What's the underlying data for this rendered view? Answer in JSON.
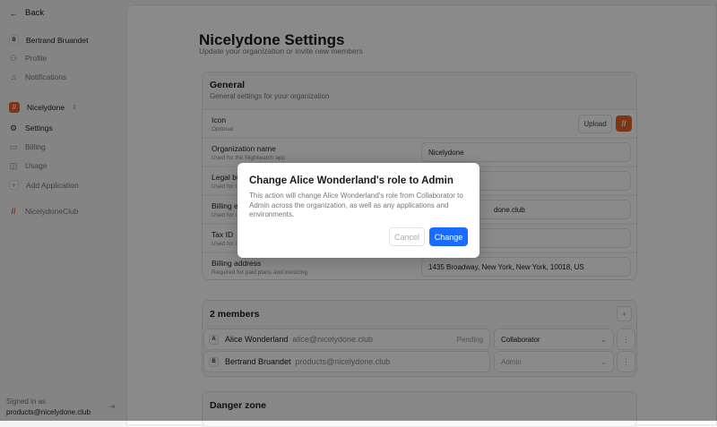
{
  "sidebar": {
    "back": "Back",
    "user": {
      "initial": "B",
      "name": "Bertrand Bruandet"
    },
    "user_items": [
      {
        "label": "Profile",
        "icon": "user-icon"
      },
      {
        "label": "Notifications",
        "icon": "bell-icon"
      }
    ],
    "org": {
      "name": "Nicelydone"
    },
    "org_items": [
      {
        "label": "Settings"
      },
      {
        "label": "Billing"
      },
      {
        "label": "Usage"
      },
      {
        "label": "Add Application"
      }
    ],
    "other_org": "NicelydoneClub",
    "signed_in_label": "Signed in as",
    "signed_in_email": "products@nicelydone.club"
  },
  "page": {
    "title": "Nicelydone Settings",
    "subtitle": "Update your organization or invite new members"
  },
  "general": {
    "title": "General",
    "subtitle": "General settings for your organization",
    "icon_label": "Icon",
    "icon_sub": "Optional",
    "upload": "Upload",
    "rows": [
      {
        "label": "Organization name",
        "sub": "Used for the Nightwatch app",
        "value": "Nicelydone"
      },
      {
        "label": "Legal bu",
        "sub": "Used for i",
        "value": ""
      },
      {
        "label": "Billing em",
        "sub": "Used for i",
        "value": "done.club"
      },
      {
        "label": "Tax ID",
        "sub": "Used for i",
        "value": ""
      },
      {
        "label": "Billing address",
        "sub": "Required for paid plans and invoicing",
        "value": "1435 Broadway, New York, New York, 10018, US"
      }
    ]
  },
  "members": {
    "title": "2 members",
    "list": [
      {
        "initial": "A",
        "name": "Alice Wonderland",
        "email": "alice@nicelydone.club",
        "status": "Pending",
        "role": "Collaborator"
      },
      {
        "initial": "B",
        "name": "Bertrand Bruandet",
        "email": "products@nicelydone.club",
        "status": "",
        "role": "Admin"
      }
    ]
  },
  "danger": {
    "title": "Danger zone"
  },
  "modal": {
    "title": "Change Alice Wonderland's role to Admin",
    "body": "This action will change Alice Wonderland's role from Collaborator to Admin across the organization, as well as any applications and environments.",
    "cancel": "Cancel",
    "confirm": "Change"
  },
  "colors": {
    "accent": "#1a6bff",
    "brand": "#e8602c"
  }
}
